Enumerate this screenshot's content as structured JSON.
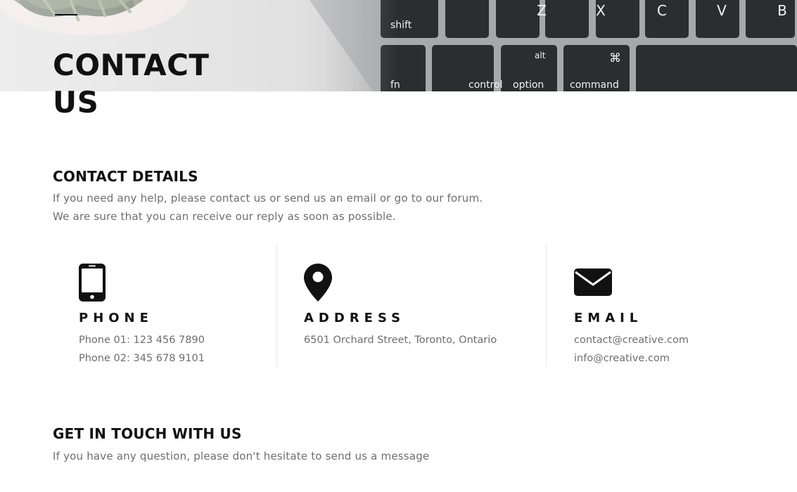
{
  "hero": {
    "title_line1": "CONTACT",
    "title_line2": "US",
    "keyboard_keys": {
      "row1": [
        "Z",
        "X",
        "C",
        "V",
        "B"
      ],
      "shift": "shift",
      "alt": "alt",
      "cmd_symbol": "⌘",
      "row3": [
        "fn",
        "control",
        "option",
        "command"
      ]
    }
  },
  "details": {
    "heading": "CONTACT DETAILS",
    "line1": "If you need any help, please contact us or send us an email or go to our forum.",
    "line2": "We are sure that you can receive our reply as soon as possible."
  },
  "cards": {
    "phone": {
      "icon": "mobile-phone-icon",
      "title": "PHONE",
      "lines": [
        "Phone 01: 123 456 7890",
        "Phone 02: 345 678 9101"
      ]
    },
    "address": {
      "icon": "map-marker-icon",
      "title": "ADDRESS",
      "lines": [
        "6501 Orchard Street, Toronto, Ontario"
      ]
    },
    "email": {
      "icon": "envelope-icon",
      "title": "EMAIL",
      "lines": [
        "contact@creative.com",
        "info@creative.com"
      ]
    }
  },
  "touch": {
    "heading": "GET IN TOUCH WITH US",
    "lead": "If you have any question, please don't hesitate to send us a message"
  },
  "colors": {
    "heading": "#111111",
    "body_text": "#6e6e6e",
    "divider": "#e8e8e8",
    "key": "#2b2d30",
    "key_text": "#f2f2f2"
  }
}
